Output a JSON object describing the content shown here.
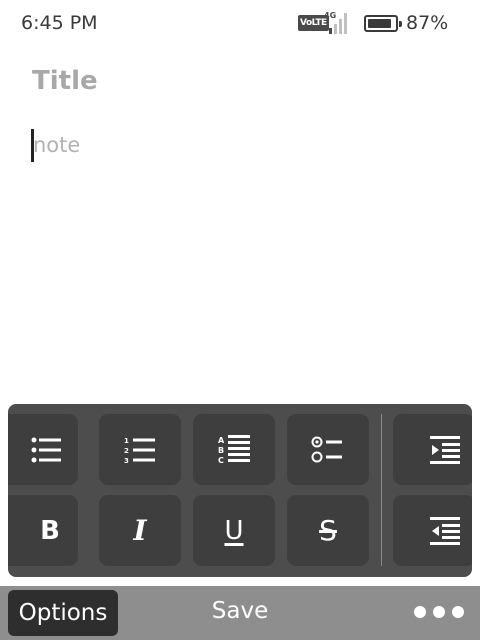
{
  "status_bar": {
    "time": "6:45 PM",
    "volte_label": "VoLTE",
    "network_type": "4G",
    "signal_level": 1,
    "signal_max": 4,
    "battery_percent_label": "87%",
    "battery_level": 0.87
  },
  "note": {
    "title_placeholder": "Title",
    "body_placeholder": "note"
  },
  "toolbar": {
    "row1": [
      {
        "name": "bullet-list-button",
        "icon": "bullet-list-icon"
      },
      {
        "name": "numbered-list-button",
        "icon": "numbered-list-icon"
      },
      {
        "name": "lettered-list-button",
        "icon": "lettered-list-icon"
      },
      {
        "name": "checklist-button",
        "icon": "checklist-icon"
      },
      {
        "name": "indent-button",
        "icon": "indent-icon"
      }
    ],
    "row2": [
      {
        "name": "bold-button",
        "glyph": "B"
      },
      {
        "name": "italic-button",
        "glyph": "I"
      },
      {
        "name": "underline-button",
        "glyph": "U"
      },
      {
        "name": "strikethrough-button",
        "glyph": "S"
      },
      {
        "name": "outdent-button",
        "icon": "outdent-icon"
      }
    ]
  },
  "softkeys": {
    "left": "Options",
    "center": "Save",
    "right_icon": "more-dots-icon"
  },
  "colors": {
    "toolbar_bg": "#4d4d4d",
    "button_bg": "#3e3e3e",
    "softkey_bar_bg": "#8e8e8e",
    "softkey_active_bg": "#2e2e2e"
  }
}
